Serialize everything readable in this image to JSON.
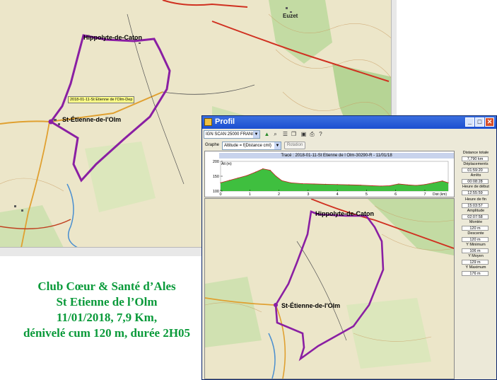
{
  "caption": {
    "line1": "Club Cœur & Santé d’Ales",
    "line2": "St Etienne de l’Olm",
    "line3": "11/01/2018,       7,9 Km,",
    "line4": "dénivelé cum 120 m, durée 2H05"
  },
  "bigmap": {
    "labels": {
      "hippolyte": "Hippolyte-de-Caton",
      "etienne": "St-Étienne-de-l'Olm",
      "tooltip": "2018-01-11-St Etienne de l'Olm-Dep",
      "euzet": "Euzet"
    }
  },
  "window": {
    "title": "Profil",
    "controls": {
      "minimize": "_",
      "maximize": "□",
      "close": "✕"
    },
    "toolbar": {
      "map_select": "IGN SCAN 25000 FRANCE",
      "icons": [
        "profile-icon",
        "zoom-icon",
        "list-icon",
        "layers-icon",
        "export-icon",
        "print-icon",
        "help-icon"
      ]
    },
    "graph": {
      "label": "Graphe",
      "select": "Altitude = f(Distance cml)",
      "rotation_button": "Rotation"
    },
    "profile": {
      "title": "Tracé : 2018-01-11-St Etienne de l Olm-30290-R - 11/01/18",
      "y_label": "Alt (m)",
      "x_label": "Dist (km)",
      "fill_color": "#3fbf3f"
    },
    "info": {
      "distance_label": "Distance totale",
      "distance_value": "7,790 km",
      "deplacements_label": "Déplacements",
      "deplacements_value": "01:59:20",
      "arrets_label": "Arrêts",
      "arrets_value": "00:08:28",
      "heure_debut_label": "Heure de début",
      "heure_debut_value": "12:55:59",
      "heure_fin_label": "Heure de fin",
      "heure_fin_value": "15:03:57",
      "amplitude_label": "Amplitude",
      "amplitude_value": "02:07:58",
      "montee_label": "Montée",
      "montee_value": "120 m",
      "descente_label": "Descente",
      "descente_value": "120 m",
      "ymin_label": "Y Minimum",
      "ymin_value": "106 m",
      "ymoy_label": "Y Moyen",
      "ymoy_value": "129 m",
      "ymax_label": "Y Maximum",
      "ymax_value": "176 m"
    },
    "minimap": {
      "labels": {
        "hippolyte": "Hippolyte-de-Caton",
        "etienne": "St-Étienne-de-l'Olm"
      }
    }
  },
  "chart_data": {
    "type": "area",
    "title": "Tracé : 2018-01-11-St Etienne de l Olm-30290-R - 11/01/18",
    "xlabel": "Dist (km)",
    "ylabel": "Alt (m)",
    "xlim": [
      0,
      7.8
    ],
    "ylim": [
      100,
      200
    ],
    "x_ticks": [
      0,
      1,
      2,
      3,
      4,
      5,
      6,
      7
    ],
    "y_ticks": [
      100,
      150,
      200
    ],
    "x": [
      0,
      0.3,
      0.6,
      0.9,
      1.2,
      1.45,
      1.7,
      1.9,
      2.1,
      2.4,
      2.8,
      3.2,
      3.6,
      4.0,
      4.4,
      4.8,
      5.2,
      5.5,
      5.8,
      6.1,
      6.4,
      6.7,
      7.0,
      7.3,
      7.6,
      7.8
    ],
    "y": [
      128,
      136,
      144,
      152,
      164,
      175,
      170,
      150,
      135,
      128,
      125,
      124,
      123,
      122,
      121,
      120,
      118,
      117,
      118,
      124,
      121,
      119,
      122,
      128,
      134,
      128
    ]
  }
}
